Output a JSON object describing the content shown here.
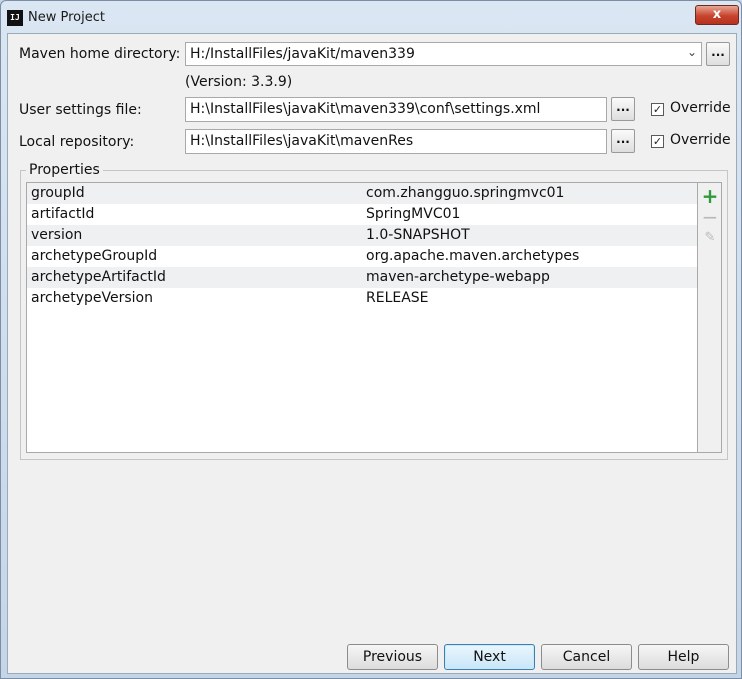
{
  "window": {
    "title": "New Project",
    "close_glyph": "x"
  },
  "maven_home": {
    "label": "Maven home directory:",
    "value": "H:/InstallFiles/javaKit/maven339",
    "version": "(Version: 3.3.9)"
  },
  "user_settings": {
    "label": "User settings file:",
    "value": "H:\\InstallFiles\\javaKit\\maven339\\conf\\settings.xml",
    "override_label": "Override",
    "override_checked": true
  },
  "local_repo": {
    "label": "Local repository:",
    "value": "H:\\InstallFiles\\javaKit\\mavenRes",
    "override_label": "Override",
    "override_checked": true
  },
  "browse_label": "...",
  "properties": {
    "title": "Properties",
    "rows": [
      {
        "key": "groupId",
        "value": "com.zhangguo.springmvc01"
      },
      {
        "key": "artifactId",
        "value": "SpringMVC01"
      },
      {
        "key": "version",
        "value": "1.0-SNAPSHOT"
      },
      {
        "key": "archetypeGroupId",
        "value": "org.apache.maven.archetypes"
      },
      {
        "key": "archetypeArtifactId",
        "value": "maven-archetype-webapp"
      },
      {
        "key": "archetypeVersion",
        "value": "RELEASE"
      }
    ],
    "tools": {
      "add_icon": "plus-icon",
      "remove_icon": "minus-icon",
      "edit_icon": "pencil-icon"
    }
  },
  "buttons": {
    "previous": "Previous",
    "next": "Next",
    "cancel": "Cancel",
    "help": "Help"
  },
  "colors": {
    "add_green": "#2e9a3a",
    "close_red": "#c8432c",
    "default_button_border": "#3c7fb1"
  }
}
